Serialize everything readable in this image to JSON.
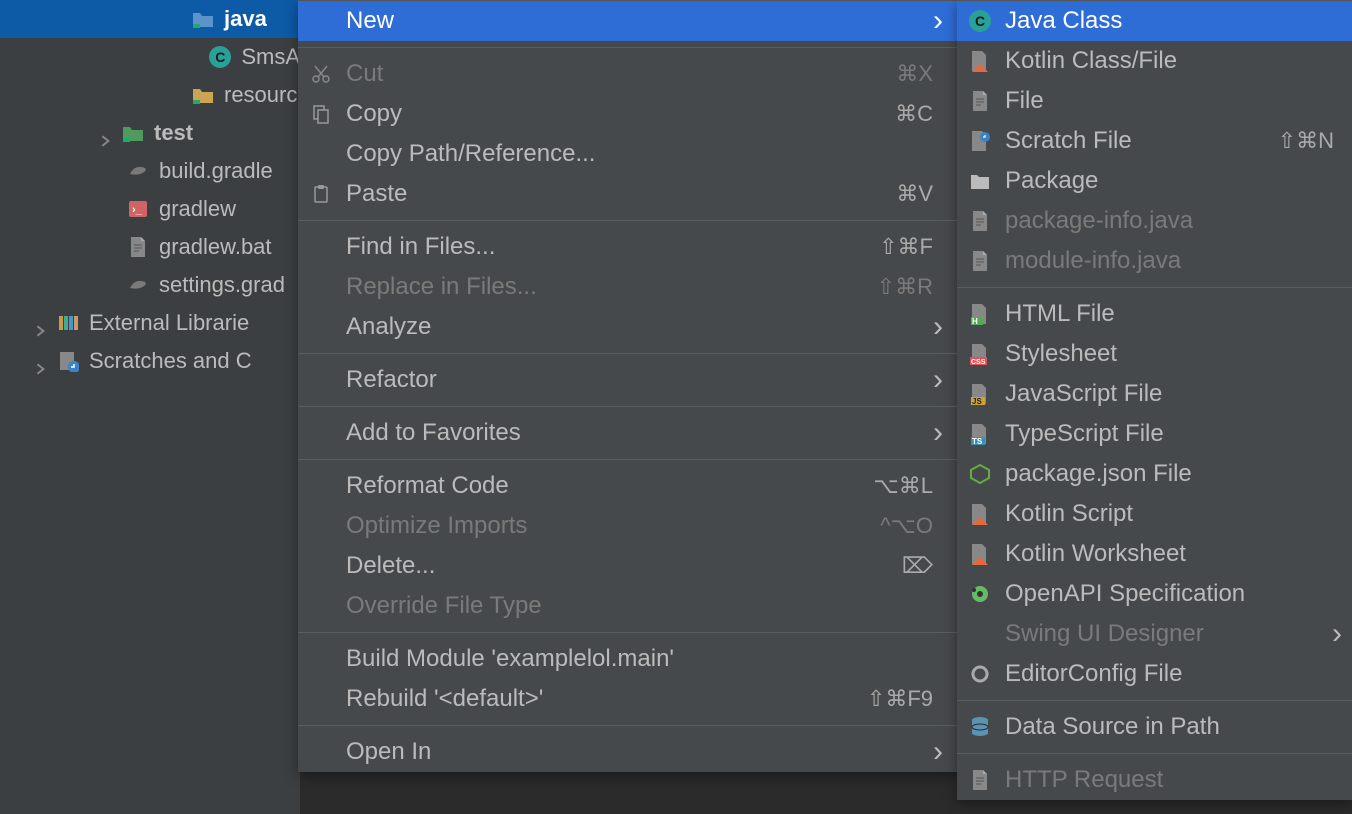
{
  "tree": {
    "items": [
      {
        "label": "java",
        "bold": true,
        "selected": true,
        "indent": 140,
        "chevron": "none",
        "icon": "folder-src"
      },
      {
        "label": "SmsA",
        "indent": 175,
        "chevron": "none",
        "icon": "class-c"
      },
      {
        "label": "resourc",
        "indent": 140,
        "chevron": "none",
        "icon": "folder-res"
      },
      {
        "label": "test",
        "bold": true,
        "indent": 70,
        "chevron": "closed",
        "icon": "folder-test"
      },
      {
        "label": "build.gradle",
        "indent": 75,
        "chevron": "none",
        "icon": "gradle"
      },
      {
        "label": "gradlew",
        "indent": 75,
        "chevron": "none",
        "icon": "shell"
      },
      {
        "label": "gradlew.bat",
        "indent": 75,
        "chevron": "none",
        "icon": "file"
      },
      {
        "label": "settings.grad",
        "indent": 75,
        "chevron": "none",
        "icon": "gradle"
      },
      {
        "label": "External Librarie",
        "indent": 5,
        "chevron": "closed",
        "icon": "lib"
      },
      {
        "label": "Scratches and C",
        "indent": 5,
        "chevron": "closed",
        "icon": "scratch"
      }
    ]
  },
  "contextMenu": {
    "groups": [
      [
        {
          "label": "New",
          "selected": true,
          "sub": true
        }
      ],
      [
        {
          "label": "Cut",
          "shortcut": "⌘X",
          "icon": "cut",
          "disabled": true
        },
        {
          "label": "Copy",
          "shortcut": "⌘C",
          "icon": "copy"
        },
        {
          "label": "Copy Path/Reference..."
        },
        {
          "label": "Paste",
          "shortcut": "⌘V",
          "icon": "paste"
        }
      ],
      [
        {
          "label": "Find in Files...",
          "shortcut": "⇧⌘F"
        },
        {
          "label": "Replace in Files...",
          "shortcut": "⇧⌘R",
          "disabled": true
        },
        {
          "label": "Analyze",
          "sub": true
        }
      ],
      [
        {
          "label": "Refactor",
          "sub": true
        }
      ],
      [
        {
          "label": "Add to Favorites",
          "sub": true
        }
      ],
      [
        {
          "label": "Reformat Code",
          "shortcut": "⌥⌘L"
        },
        {
          "label": "Optimize Imports",
          "shortcut": "^⌥O",
          "disabled": true
        },
        {
          "label": "Delete...",
          "shortcut": "⌦"
        },
        {
          "label": "Override File Type",
          "disabled": true
        }
      ],
      [
        {
          "label": "Build Module 'examplelol.main'"
        },
        {
          "label": "Rebuild '<default>'",
          "shortcut": "⇧⌘F9"
        }
      ],
      [
        {
          "label": "Open In",
          "sub": true
        }
      ]
    ]
  },
  "submenu": {
    "groups": [
      [
        {
          "label": "Java Class",
          "icon": "class-c",
          "selected": true
        },
        {
          "label": "Kotlin Class/File",
          "icon": "kotlin"
        },
        {
          "label": "File",
          "icon": "file"
        },
        {
          "label": "Scratch File",
          "icon": "scratch-file",
          "shortcut": "⇧⌘N"
        },
        {
          "label": "Package",
          "icon": "package"
        },
        {
          "label": "package-info.java",
          "icon": "file-dim",
          "disabled": true
        },
        {
          "label": "module-info.java",
          "icon": "file-dim",
          "disabled": true
        }
      ],
      [
        {
          "label": "HTML File",
          "icon": "html"
        },
        {
          "label": "Stylesheet",
          "icon": "css"
        },
        {
          "label": "JavaScript File",
          "icon": "js"
        },
        {
          "label": "TypeScript File",
          "icon": "ts"
        },
        {
          "label": "package.json File",
          "icon": "node"
        },
        {
          "label": "Kotlin Script",
          "icon": "kotlin"
        },
        {
          "label": "Kotlin Worksheet",
          "icon": "kotlin"
        },
        {
          "label": "OpenAPI Specification",
          "icon": "openapi"
        },
        {
          "label": "Swing UI Designer",
          "disabled": true,
          "sub": true
        },
        {
          "label": "EditorConfig File",
          "icon": "gear"
        }
      ],
      [
        {
          "label": "Data Source in Path",
          "icon": "db"
        }
      ],
      [
        {
          "label": "HTTP Request",
          "icon": "file-dim",
          "disabled": true
        }
      ]
    ]
  }
}
